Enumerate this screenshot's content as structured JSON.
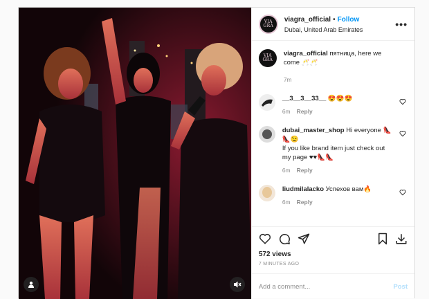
{
  "post": {
    "username": "viagra_official",
    "follow_label": "Follow",
    "dot": "•",
    "location": "Dubai, United Arab Emirates",
    "more_label": "•••",
    "avatar_text": "VIA GRA",
    "caption": {
      "username": "viagra_official",
      "text": " пятница, here we come 🥂🥂",
      "time": "7m"
    },
    "comments": [
      {
        "username": "__3__3__33__",
        "text": " 😍😍😍",
        "time": "6m",
        "reply": "Reply"
      },
      {
        "username": "dubai_master_shop",
        "text": " Hi everyone 👠👠😉",
        "text2": "If you like brand item just check out my page ♥♥👠👠",
        "time": "6m",
        "reply": "Reply"
      },
      {
        "username": "liudmilalacko",
        "text": " Успехов вам🔥",
        "time": "6m",
        "reply": "Reply"
      }
    ],
    "views": "572 views",
    "timestamp": "7 MINUTES AGO",
    "add_comment_placeholder": "Add a comment...",
    "post_button": "Post"
  },
  "colors": {
    "link_blue": "#0095f6",
    "post_disabled": "#b2dffc",
    "muted": "#8e8e8e",
    "text": "#262626"
  },
  "icons": [
    "more-icon",
    "heart-icon",
    "comment-icon",
    "share-icon",
    "bookmark-icon",
    "download-icon",
    "tag-icon",
    "mute-icon"
  ]
}
